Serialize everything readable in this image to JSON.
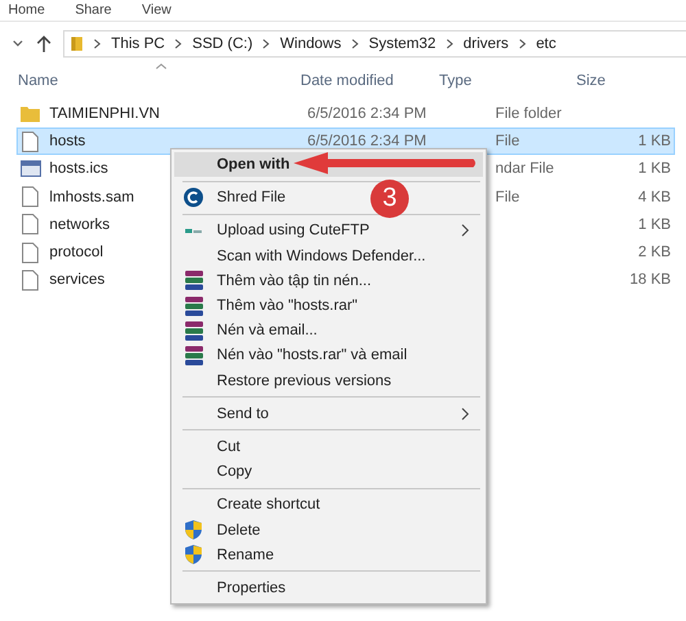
{
  "ribbon_tabs": [
    "Home",
    "Share",
    "View"
  ],
  "breadcrumb": [
    "This PC",
    "SSD (C:)",
    "Windows",
    "System32",
    "drivers",
    "etc"
  ],
  "columns": [
    "Name",
    "Date modified",
    "Type",
    "Size"
  ],
  "rows": [
    {
      "kind": "folder",
      "name": "TAIMIENPHI.VN",
      "date": "6/5/2016 2:34 PM",
      "type": "File folder",
      "size": "",
      "selected": false
    },
    {
      "kind": "file",
      "name": "hosts",
      "date": "6/5/2016 2:34 PM",
      "type": "File",
      "size": "1 KB",
      "selected": true
    },
    {
      "kind": "calendar",
      "name": "hosts.ics",
      "date": "",
      "type": "ndar File",
      "size": "1 KB",
      "selected": false
    },
    {
      "kind": "file",
      "name": "lmhosts.sam",
      "date": "",
      "type": "File",
      "size": "4 KB",
      "selected": false
    },
    {
      "kind": "file",
      "name": "networks",
      "date": "",
      "type": "",
      "size": "1 KB",
      "selected": false
    },
    {
      "kind": "file",
      "name": "protocol",
      "date": "",
      "type": "",
      "size": "2 KB",
      "selected": false
    },
    {
      "kind": "file",
      "name": "services",
      "date": "",
      "type": "",
      "size": "18 KB",
      "selected": false
    }
  ],
  "menu": [
    {
      "kind": "plain",
      "label": "Open with",
      "bold": true,
      "selected": true
    },
    {
      "kind": "separator"
    },
    {
      "kind": "shred",
      "label": "Shred File",
      "selected": false
    },
    {
      "kind": "separator"
    },
    {
      "kind": "upload",
      "label": "Upload using CuteFTP",
      "submenu": true,
      "selected": false
    },
    {
      "kind": "plain",
      "label": "Scan with Windows Defender...",
      "selected": false
    },
    {
      "kind": "archive",
      "label": "Thêm vào tập tin nén...",
      "selected": false
    },
    {
      "kind": "archive",
      "label": "Thêm vào \"hosts.rar\"",
      "selected": false
    },
    {
      "kind": "archive",
      "label": "Nén và email...",
      "selected": false
    },
    {
      "kind": "archive",
      "label": "Nén vào \"hosts.rar\" và email",
      "selected": false
    },
    {
      "kind": "plain",
      "label": "Restore previous versions",
      "selected": false
    },
    {
      "kind": "separator"
    },
    {
      "kind": "plain",
      "label": "Send to",
      "submenu": true,
      "selected": false
    },
    {
      "kind": "separator"
    },
    {
      "kind": "plain",
      "label": "Cut",
      "selected": false
    },
    {
      "kind": "plain",
      "label": "Copy",
      "selected": false
    },
    {
      "kind": "separator"
    },
    {
      "kind": "plain",
      "label": "Create shortcut",
      "selected": false
    },
    {
      "kind": "shield",
      "label": "Delete",
      "selected": false
    },
    {
      "kind": "shield",
      "label": "Rename",
      "selected": false
    },
    {
      "kind": "separator"
    },
    {
      "kind": "plain",
      "label": "Properties",
      "selected": false
    }
  ],
  "step_badge": "3"
}
